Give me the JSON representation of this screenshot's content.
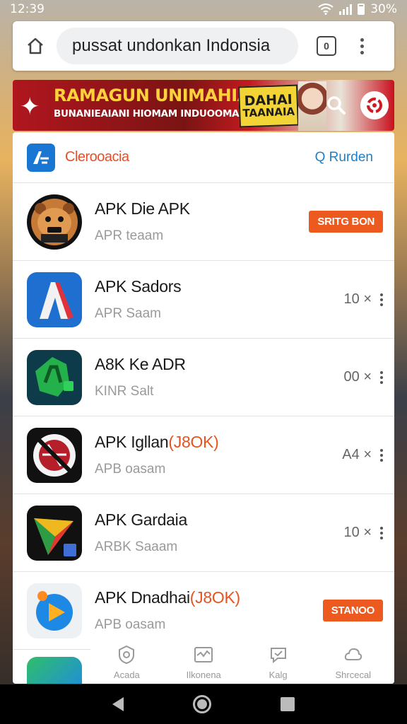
{
  "status_bar": {
    "time": "12:39",
    "battery": "30%"
  },
  "browser": {
    "url": "pussat undonkan Indonsia",
    "tab_count": "0"
  },
  "banner": {
    "title": "RAMAGUN UNIMAHIAN",
    "subtitle": "BUNANIEAIANI HIOMAM INDUOOMAIN",
    "badge_line1": "DAHAI",
    "badge_line2": "TAANAIA"
  },
  "header": {
    "brand": "Clerooacia",
    "action": "Q Rurden"
  },
  "apps": [
    {
      "title": "APK Die APK",
      "title_highlight": "",
      "subtitle": "APR teaam",
      "count": "",
      "button": "SRITG BON"
    },
    {
      "title": "APK Sadors",
      "title_highlight": "",
      "subtitle": "APR Saam",
      "count": "10 ×",
      "button": ""
    },
    {
      "title": "A8K Ke ADR",
      "title_highlight": "",
      "subtitle": "KINR Salt",
      "count": "00 ×",
      "button": ""
    },
    {
      "title": "APK Igllan",
      "title_highlight": "(J8OK)",
      "subtitle": "APB oasam",
      "count": "A4 ×",
      "button": ""
    },
    {
      "title": "APK Gardaia",
      "title_highlight": "",
      "subtitle": "ARBK Saaam",
      "count": "10 ×",
      "button": ""
    },
    {
      "title": "APK Dnadhai",
      "title_highlight": "(J8OK)",
      "subtitle": "APB oasam",
      "count": "",
      "button": "STANOO"
    }
  ],
  "bottom_tabs": [
    {
      "label": "Acada",
      "icon": "shield-icon"
    },
    {
      "label": "Ilkonena",
      "icon": "chart-icon"
    },
    {
      "label": "Kalg",
      "icon": "chat-icon"
    },
    {
      "label": "Shrcecal",
      "icon": "cloud-icon"
    }
  ],
  "colors": {
    "accent": "#ec5a20",
    "link": "#1f7fc4",
    "brand": "#1976d2"
  }
}
